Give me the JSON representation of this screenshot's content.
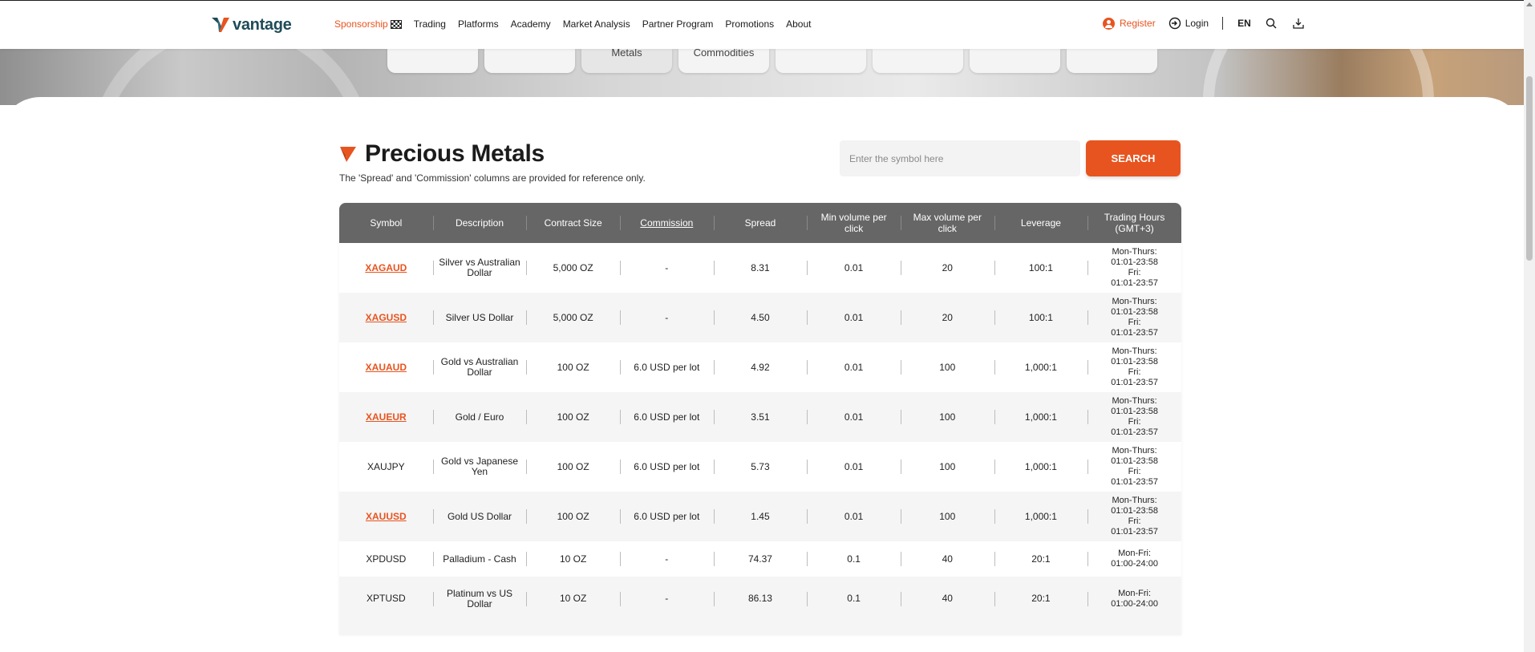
{
  "brand": {
    "name": "vantage"
  },
  "nav": {
    "items": [
      "Trading",
      "Platforms",
      "Academy",
      "Market Analysis",
      "Partner Program",
      "Promotions",
      "About"
    ],
    "sponsorship": "Sponsorship",
    "register": "Register",
    "login": "Login",
    "language": "EN"
  },
  "hero": {
    "tabs": [
      "",
      "",
      "Metals",
      "Commodities",
      "",
      "",
      "",
      ""
    ]
  },
  "section": {
    "title": "Precious Metals",
    "note": "The 'Spread' and 'Commission' columns are provided for reference only."
  },
  "search": {
    "placeholder": "Enter the symbol here",
    "button": "SEARCH"
  },
  "table": {
    "headers": [
      "Symbol",
      "Description",
      "Contract Size",
      "Commission",
      "Spread",
      "Min volume per click",
      "Max volume per click",
      "Leverage",
      "Trading Hours (GMT+3)"
    ],
    "rows": [
      {
        "symbol": "XAGAUD",
        "link": true,
        "description": "Silver vs Australian Dollar",
        "contract": "5,000 OZ",
        "commission": "-",
        "spread": "8.31",
        "min": "0.01",
        "max": "20",
        "leverage": "100:1",
        "hours": [
          "Mon-Thurs:",
          "01:01-23:58",
          "Fri:",
          "01:01-23:57"
        ]
      },
      {
        "symbol": "XAGUSD",
        "link": true,
        "description": "Silver US Dollar",
        "contract": "5,000 OZ",
        "commission": "-",
        "spread": "4.50",
        "min": "0.01",
        "max": "20",
        "leverage": "100:1",
        "hours": [
          "Mon-Thurs:",
          "01:01-23:58",
          "Fri:",
          "01:01-23:57"
        ]
      },
      {
        "symbol": "XAUAUD",
        "link": true,
        "description": "Gold vs Australian Dollar",
        "contract": "100 OZ",
        "commission": "6.0 USD per lot",
        "spread": "4.92",
        "min": "0.01",
        "max": "100",
        "leverage": "1,000:1",
        "hours": [
          "Mon-Thurs:",
          "01:01-23:58",
          "Fri:",
          "01:01-23:57"
        ]
      },
      {
        "symbol": "XAUEUR",
        "link": true,
        "description": "Gold / Euro",
        "contract": "100 OZ",
        "commission": "6.0 USD per lot",
        "spread": "3.51",
        "min": "0.01",
        "max": "100",
        "leverage": "1,000:1",
        "hours": [
          "Mon-Thurs:",
          "01:01-23:58",
          "Fri:",
          "01:01-23:57"
        ]
      },
      {
        "symbol": "XAUJPY",
        "link": false,
        "description": "Gold vs Japanese Yen",
        "contract": "100 OZ",
        "commission": "6.0 USD per lot",
        "spread": "5.73",
        "min": "0.01",
        "max": "100",
        "leverage": "1,000:1",
        "hours": [
          "Mon-Thurs:",
          "01:01-23:58",
          "Fri:",
          "01:01-23:57"
        ]
      },
      {
        "symbol": "XAUUSD",
        "link": true,
        "description": "Gold US Dollar",
        "contract": "100 OZ",
        "commission": "6.0 USD per lot",
        "spread": "1.45",
        "min": "0.01",
        "max": "100",
        "leverage": "1,000:1",
        "hours": [
          "Mon-Thurs:",
          "01:01-23:58",
          "Fri:",
          "01:01-23:57"
        ]
      },
      {
        "symbol": "XPDUSD",
        "link": false,
        "description": "Palladium - Cash",
        "contract": "10 OZ",
        "commission": "-",
        "spread": "74.37",
        "min": "0.1",
        "max": "40",
        "leverage": "20:1",
        "hours": [
          "Mon-Fri:",
          "01:00-24:00"
        ]
      },
      {
        "symbol": "XPTUSD",
        "link": false,
        "description": "Platinum vs US Dollar",
        "contract": "10 OZ",
        "commission": "-",
        "spread": "86.13",
        "min": "0.1",
        "max": "40",
        "leverage": "20:1",
        "hours": [
          "Mon-Fri:",
          "01:00-24:00"
        ]
      }
    ]
  },
  "colors": {
    "accent": "#e8541f",
    "header_bg": "#666666",
    "brand": "#1f4b58"
  }
}
